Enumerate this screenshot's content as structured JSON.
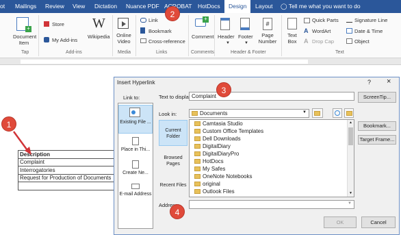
{
  "tabs": [
    "ot",
    "Mailings",
    "Review",
    "View",
    "Dictation",
    "Nuance PDF",
    "ACROBAT",
    "HotDocs",
    "Design",
    "Layout"
  ],
  "tell_me": "Tell me what you want to do",
  "ribbon": {
    "document_item": "Document Item",
    "store": "Store",
    "my_addins": "My Add-ins",
    "wikipedia": "Wikipedia",
    "online_video": "Online Video",
    "link": "Link",
    "bookmark": "Bookmark",
    "cross_reference": "Cross-reference",
    "comment": "Comment",
    "header": "Header",
    "footer": "Footer",
    "page_number": "Page Number",
    "text_box": "Text Box",
    "quick_parts": "Quick Parts",
    "wordart": "WordArt",
    "drop_cap": "Drop Cap",
    "signature_line": "Signature Line",
    "date_time": "Date & Time",
    "object": "Object",
    "groups": {
      "tap": "Tap",
      "addins": "Add-ins",
      "media": "Media",
      "links": "Links",
      "comments": "Comments",
      "header_footer": "Header & Footer",
      "text": "Text"
    }
  },
  "document_table": [
    "Description",
    "Complaint",
    "Interrogatories",
    "Request for Production of Documents",
    ""
  ],
  "dialog": {
    "title": "Insert Hyperlink",
    "help": "?",
    "close": "×",
    "link_to": "Link to:",
    "link_options": [
      "Existing File or Web Page",
      "Place in This Document",
      "Create New Document",
      "E-mail Address"
    ],
    "link_options_short": [
      "Existing File ...",
      "Place in Thi...",
      "Create Ne...",
      "E-mail Address"
    ],
    "text_to_display_label": "Text to display:",
    "text_to_display_value": "Complaint",
    "screentip": "ScreenTip...",
    "look_in_label": "Look in:",
    "look_in_value": "Documents",
    "nav": [
      "Current Folder",
      "Browsed Pages",
      "Recent Files"
    ],
    "files": [
      "Camtasia Studio",
      "Custom Office Templates",
      "Dell Downloads",
      "DigitalDiary",
      "DigitalDiaryPro",
      "HotDocs",
      "My Safes",
      "OneNote Notebooks",
      "original",
      "Outlook Files"
    ],
    "bookmark": "Bookmark...",
    "target_frame": "Target Frame...",
    "address_label": "Address:",
    "address_value": "",
    "ok": "OK",
    "cancel": "Cancel"
  },
  "callouts": [
    "1",
    "2",
    "3",
    "4"
  ],
  "colors": {
    "ribbon_blue": "#2b579a",
    "callout_red": "#e04a3a",
    "selected_blue": "#cce4f7"
  }
}
